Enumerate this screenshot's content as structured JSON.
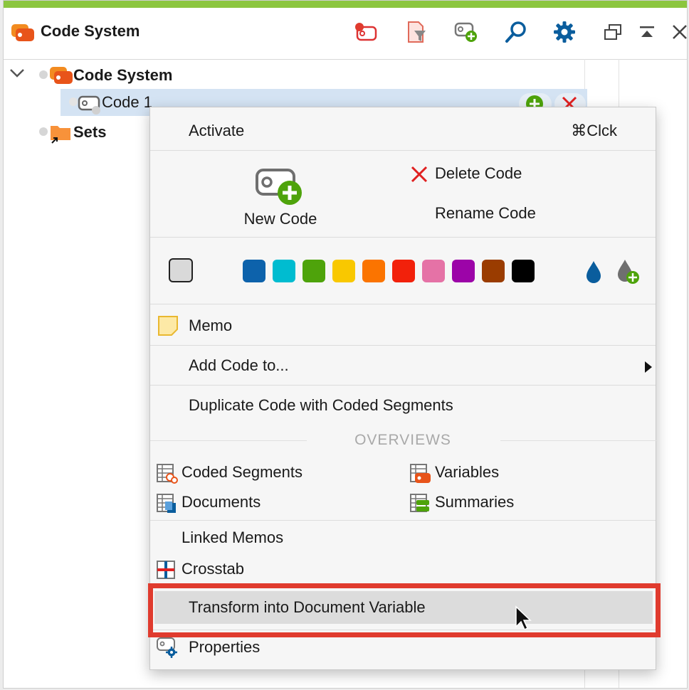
{
  "header": {
    "title": "Code System",
    "accent_color": "#8cc63f",
    "tools": [
      "activate-code-icon",
      "filter-icon",
      "new-code-icon",
      "search-icon",
      "settings-icon",
      "undock-window-icon",
      "collapse-icon",
      "close-icon"
    ]
  },
  "tree": {
    "root_label": "Code System",
    "code1_label": "Code 1",
    "sets_label": "Sets"
  },
  "menu": {
    "activate": "Activate",
    "activate_shortcut": "⌘Clck",
    "new_code": "New Code",
    "delete_code": "Delete Code",
    "rename_code": "Rename Code",
    "colors": [
      "#0d62ab",
      "#00bcd0",
      "#4ea30b",
      "#f9c800",
      "#fb7400",
      "#f2210b",
      "#e572a6",
      "#9c04a8",
      "#9a3c00",
      "#000000"
    ],
    "memo": "Memo",
    "add_code_to": "Add Code to...",
    "duplicate": "Duplicate Code with Coded Segments",
    "overviews_heading": "OVERVIEWS",
    "coded_segments": "Coded Segments",
    "variables": "Variables",
    "documents": "Documents",
    "summaries": "Summaries",
    "linked_memos": "Linked Memos",
    "crosstab": "Crosstab",
    "transform": "Transform into Document Variable",
    "properties": "Properties"
  }
}
